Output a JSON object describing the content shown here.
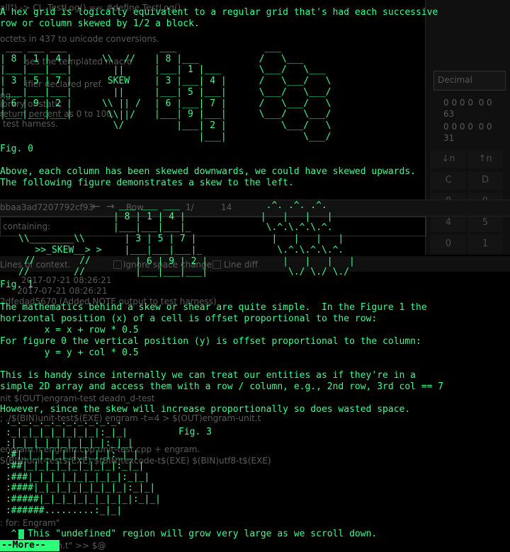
{
  "background_windows": {
    "editor_lines": [
      "all\") -> CL_TestLog() == #define TestLog()",
      "octets in 437 to unicode conversions.",
      "ses the templated macro",
      "ifier declared pref.",
      "ng...",
      "ibrary of static",
      "return percent as 0 to 100.",
      "test harness."
    ],
    "calculator": {
      "mode": "Decimal",
      "display_lines": [
        "0 0 0 0  0 0",
        "63",
        "0 0 0 0  0 0",
        "31"
      ],
      "buttons": [
        [
          "↓n",
          "↑n"
        ],
        [
          "C",
          "D"
        ],
        [
          "8",
          "9"
        ],
        [
          "4",
          "5"
        ],
        [
          "0",
          "1"
        ]
      ]
    },
    "git_view": {
      "commit_hash": "bbaa3ad7207792cf93",
      "row_label": "Row",
      "row_value": "1/",
      "row_total": "14",
      "search_label": "containing:",
      "context_label": "Lines of context.",
      "ignore_label": "Ignore space change",
      "line_diff_label": "Line diff",
      "dates": [
        "2017-07-21 08:26:21",
        "2017-07-21 08:26:21"
      ],
      "commit_message": "2dfedad5670 (Added NOTE output to test harness)"
    },
    "make_lines": [
      "nit $(OUT)engram-test deadn_d-test",
      "; ./$(BIN)unit-test$(EXE) engram -t=4 > $(OUT)engram-unit.t",
      "engram.h engram.cpp unit-test.cpp + engram.",
      "S(BIN)unit-test$(EXE) $(BIN)texcode-t$(EXE) $(BIN)utf8-t$(EXE)",
      ": for: Engram\"",
      "; $(\"   platform.t\" >> $@"
    ]
  },
  "terminal": {
    "intro_line1": "A hex grid is logically equivalent to a regular grid that's had each successive",
    "intro_line2": "row or column skewed by 1/2 a block.",
    "fig0_art_left": " ___ ___ ___\n| 8 | 1 | 4 |\n|___|___|___|\n| 3 | 5 | 7 |\n|___|___|___|\n| 6 | 9 | 2 |\n|___|___|___|",
    "fig0_art_arrow": "\\\\  //\n  ||\n SKEW\n  ||\n\\\\ || /\n \\\\||/\n  \\/",
    "fig0_art_skewed": " ___\n| 8 |___\n|___| 1 |___\n| 3 |___| 4 |\n|___| 5 |___|\n| 6 |___| 7 |\n|___| 9 |___|\n    |___| 2 |\n        |___|",
    "fig0_art_hex": "   ___\n  /   \\___\n  \\___/   \\___\n  /   \\___/   \\\n  \\___/   \\___/\n  /   \\___/   \\\n  \\___/   \\___/\n      \\___/   \\\n          \\___/",
    "fig0_caption": "Fig. 0",
    "para2_line1": "Above, each column has been skewed downwards, we could have skewed upwards.",
    "para2_line2": "The following figure demonstrates a skew to the left.",
    "fig1_art_arrow": "\\\\________\\\\\n   >>_SKEW__> >\n //        //\n//        //",
    "fig1_art_grid": " ___ ___ ___\n| 8 | 1 | 4 |\n|___|___|___|_\n  | 3 | 5 | 7 |\n  |___|___|___|_\n    | 6 | 9 | 2 |\n    |___|___|___|",
    "fig1_art_hex": "  .^. .^. .^.\n |   |   |   |\n  \\.^.\\.^.\\.^.\n   |   |   |   |\n    \\.^.\\.^.\\.^.\n     |   |   |   |\n      \\./ \\./ \\./",
    "fig1_caption": "Fig. 1",
    "math_line1": "The mathematics behind a skew or shear are quite simple.  In the Figure 1 the",
    "math_line2": "horizontal position (x) of a cell is offset proportional to the row:",
    "formula_x": "        x = x + row * 0.5",
    "math_line3": "For figure 0 the vertical position (y) is offset proportional to the column:",
    "formula_y": "        y = y + col * 0.5",
    "handy_line1": "This is handy since internally we can treat our entities as if they're in a",
    "handy_line2": "simple 2D array and access them with a row / column, e.g., 2nd row, 3rd col == 7",
    "however_line": "However, since the skew will increase proportionally so does wasted space.",
    "fig3_art": " ._._._._._._._._._._.\n :_|_|_|_|_|_|_|_|:_|_|\n :|_|_|_|_|_|_|_|_|:_|_|\n :#|_|_|_|_|_|_|_|_|:_|_|\n :##|_|_|_|_|_|_|_|_|:_|_|\n :###|_|_|_|_|_|_|_|_|:_|_|\n :####|_|_|_|_|_|_|_|_|:_|_|\n :#####|_|_|_|_|_|_|_|_|:_|_|\n :######.........:_|_|",
    "fig3_caption": "Fig. 3",
    "undefined_line": "  ^- This \"undefined\" region will grow very large as we scroll down.",
    "more_prompt": "--More--"
  },
  "colors": {
    "terminal_fg": "#39ff8e",
    "terminal_bg": "#000000",
    "more_bg": "#2bff7a"
  }
}
